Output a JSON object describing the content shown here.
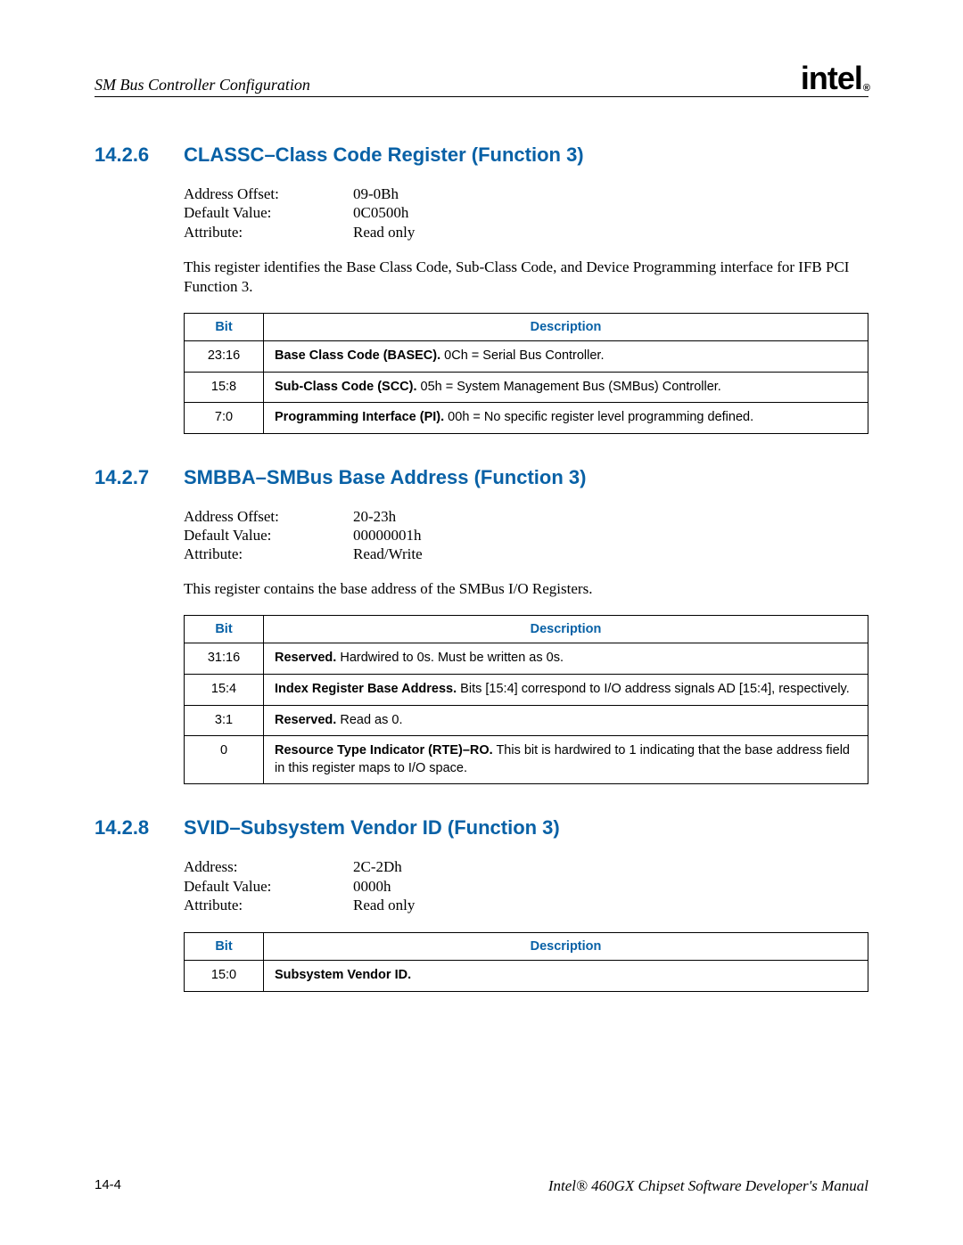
{
  "header": {
    "title": "SM Bus Controller Configuration",
    "logo_text": "intel",
    "logo_reg": "®"
  },
  "sections": [
    {
      "num": "14.2.6",
      "title": "CLASSC–Class Code Register (Function 3)",
      "attrs": [
        {
          "label": "Address Offset:",
          "value": "09-0Bh"
        },
        {
          "label": "Default Value:",
          "value": "0C0500h"
        },
        {
          "label": "Attribute:",
          "value": "Read only"
        }
      ],
      "para": "This register identifies the Base Class Code, Sub-Class Code, and Device Programming interface for IFB PCI Function 3.",
      "th_bit": "Bit",
      "th_desc": "Description",
      "rows": [
        {
          "bit": "23:16",
          "bold": "Base Class Code (BASEC).",
          "rest": " 0Ch = Serial Bus Controller."
        },
        {
          "bit": "15:8",
          "bold": "Sub-Class Code (SCC).",
          "rest": " 05h = System Management Bus (SMBus) Controller."
        },
        {
          "bit": "7:0",
          "bold": "Programming Interface (PI).",
          "rest": " 00h = No specific register level programming defined."
        }
      ]
    },
    {
      "num": "14.2.7",
      "title": "SMBBA–SMBus Base Address (Function 3)",
      "attrs": [
        {
          "label": "Address Offset:",
          "value": "20-23h"
        },
        {
          "label": "Default Value:",
          "value": "00000001h"
        },
        {
          "label": "Attribute:",
          "value": "Read/Write"
        }
      ],
      "para": "This register contains the base address of the SMBus I/O Registers.",
      "th_bit": "Bit",
      "th_desc": "Description",
      "rows": [
        {
          "bit": "31:16",
          "bold": "Reserved.",
          "rest": " Hardwired to 0s. Must be written as 0s."
        },
        {
          "bit": "15:4",
          "bold": "Index Register Base Address.",
          "rest": " Bits [15:4] correspond to I/O address signals AD [15:4], respectively."
        },
        {
          "bit": "3:1",
          "bold": "Reserved.",
          "rest": " Read as 0."
        },
        {
          "bit": "0",
          "bold": "Resource Type Indicator (RTE)–RO.",
          "rest": " This bit is hardwired to 1 indicating that the base address field in this register maps to I/O space."
        }
      ]
    },
    {
      "num": "14.2.8",
      "title": "SVID–Subsystem Vendor ID (Function 3)",
      "attrs": [
        {
          "label": "Address:",
          "value": "2C-2Dh"
        },
        {
          "label": "Default Value:",
          "value": "0000h"
        },
        {
          "label": "Attribute:",
          "value": "Read only"
        }
      ],
      "para": "",
      "th_bit": "Bit",
      "th_desc": "Description",
      "rows": [
        {
          "bit": "15:0",
          "bold": "Subsystem Vendor ID.",
          "rest": ""
        }
      ]
    }
  ],
  "footer": {
    "page": "14-4",
    "manual": "Intel® 460GX Chipset Software Developer's Manual"
  }
}
